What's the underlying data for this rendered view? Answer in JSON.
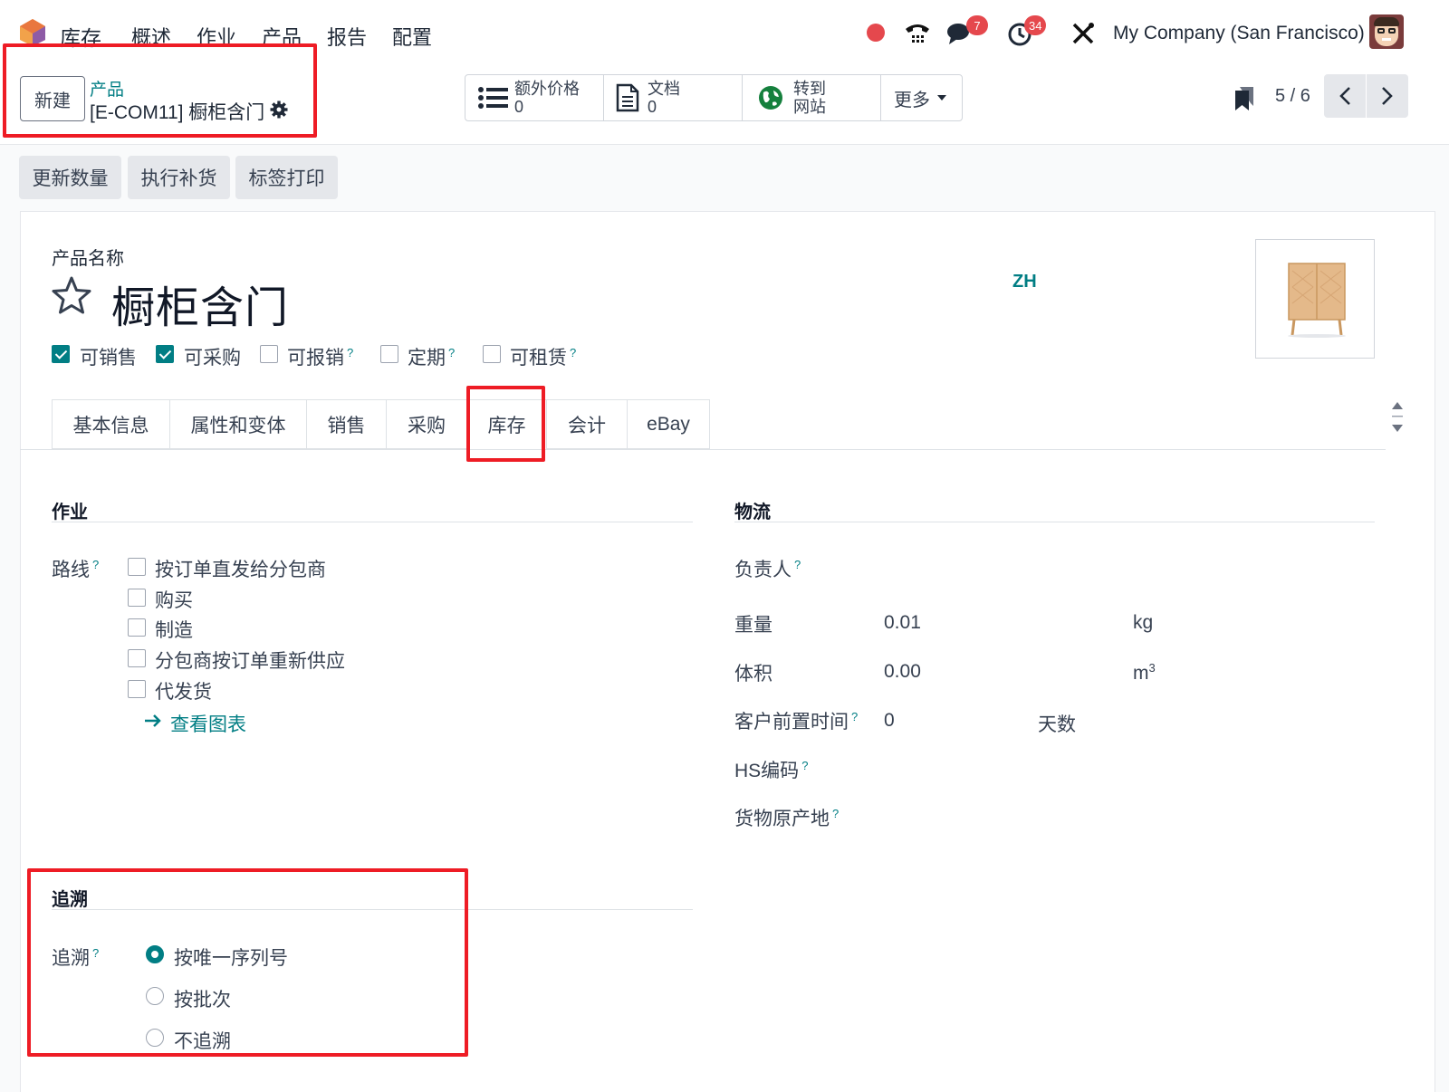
{
  "navbar": {
    "app_name": "库存",
    "menu": [
      "概述",
      "作业",
      "产品",
      "报告",
      "配置"
    ],
    "chat_badge": "7",
    "activity_badge": "34",
    "company": "My Company (San Francisco)"
  },
  "control_panel": {
    "new_button": "新建",
    "breadcrumb_parent": "产品",
    "record_title": "[E-COM11] 橱柜含门",
    "smart_buttons": [
      {
        "label": "额外价格",
        "count": "0"
      },
      {
        "label": "文档",
        "count": "0"
      },
      {
        "label": "转到",
        "label2": "网站"
      },
      {
        "label": "更多"
      }
    ],
    "pager": "5 / 6"
  },
  "actions": [
    "更新数量",
    "执行补货",
    "标签打印"
  ],
  "form": {
    "name_label": "产品名称",
    "product_name": "橱柜含门",
    "lang": "ZH",
    "options": [
      {
        "label": "可销售",
        "checked": true
      },
      {
        "label": "可采购",
        "checked": true
      },
      {
        "label": "可报销",
        "checked": false,
        "help": "?"
      },
      {
        "label": "定期",
        "checked": false,
        "help": "?"
      },
      {
        "label": "可租赁",
        "checked": false,
        "help": "?"
      }
    ],
    "tabs": [
      "基本信息",
      "属性和变体",
      "销售",
      "采购",
      "库存",
      "会计",
      "eBay"
    ],
    "active_tab": "库存"
  },
  "operations": {
    "title": "作业",
    "routes_label": "路线",
    "routes": [
      "按订单直发给分包商",
      "购买",
      "制造",
      "分包商按订单重新供应",
      "代发货"
    ],
    "view_diagram": "查看图表"
  },
  "logistics": {
    "title": "物流",
    "responsible_label": "负责人",
    "weight_label": "重量",
    "weight_value": "0.01",
    "weight_unit": "kg",
    "volume_label": "体积",
    "volume_value": "0.00",
    "volume_unit": "m",
    "volume_sup": "3",
    "lead_label": "客户前置时间",
    "lead_value": "0",
    "lead_unit": "天数",
    "hs_label": "HS编码",
    "origin_label": "货物原产地"
  },
  "traceability": {
    "title": "追溯",
    "label": "追溯",
    "options": [
      "按唯一序列号",
      "按批次",
      "不追溯"
    ],
    "selected": "按唯一序列号"
  },
  "colors": {
    "accent": "#017e84",
    "highlight": "#ee1c25"
  }
}
